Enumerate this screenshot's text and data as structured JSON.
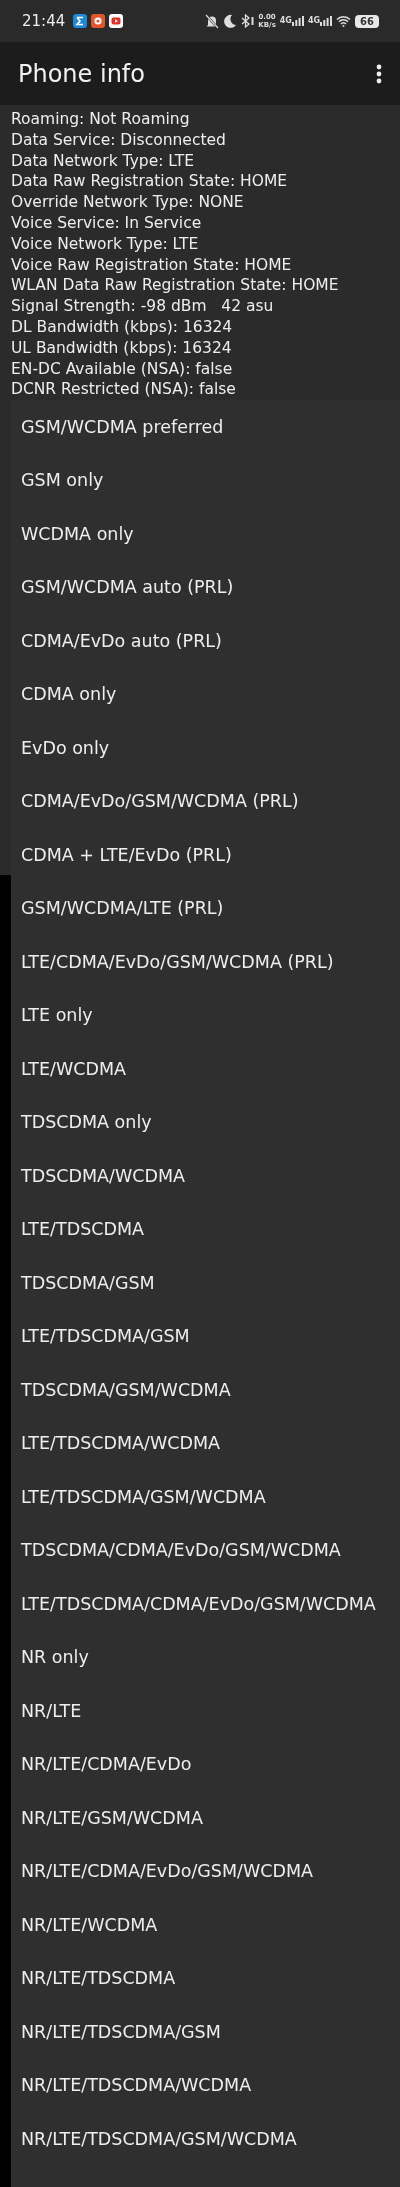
{
  "status_bar": {
    "time": "21:44",
    "net_speed": "0.00",
    "net_speed_unit": "KB/s",
    "network_1": "4G",
    "network_2": "4G",
    "battery": "66"
  },
  "app_bar": {
    "title": "Phone info"
  },
  "info_lines": [
    "Roaming: Not Roaming",
    "Data Service: Disconnected",
    "Data Network Type: LTE",
    "Data Raw Registration State: HOME",
    "Override Network Type: NONE",
    "Voice Service: In Service",
    "Voice Network Type: LTE",
    "Voice Raw Registration State: HOME",
    "WLAN Data Raw Registration State: HOME",
    "Signal Strength: -98 dBm   42 asu",
    "DL Bandwidth (kbps): 16324",
    "UL Bandwidth (kbps): 16324",
    "EN-DC Available (NSA): false",
    "DCNR Restricted (NSA): false"
  ],
  "network_type_menu": [
    "GSM/WCDMA preferred",
    "GSM only",
    "WCDMA only",
    "GSM/WCDMA auto (PRL)",
    "CDMA/EvDo auto (PRL)",
    "CDMA only",
    "EvDo only",
    "CDMA/EvDo/GSM/WCDMA (PRL)",
    "CDMA + LTE/EvDo (PRL)",
    "GSM/WCDMA/LTE (PRL)",
    "LTE/CDMA/EvDo/GSM/WCDMA (PRL)",
    "LTE only",
    "LTE/WCDMA",
    "TDSCDMA only",
    "TDSCDMA/WCDMA",
    "LTE/TDSCDMA",
    "TDSCDMA/GSM",
    "LTE/TDSCDMA/GSM",
    "TDSCDMA/GSM/WCDMA",
    "LTE/TDSCDMA/WCDMA",
    "LTE/TDSCDMA/GSM/WCDMA",
    "TDSCDMA/CDMA/EvDo/GSM/WCDMA",
    "LTE/TDSCDMA/CDMA/EvDo/GSM/WCDMA",
    "NR only",
    "NR/LTE",
    "NR/LTE/CDMA/EvDo",
    "NR/LTE/GSM/WCDMA",
    "NR/LTE/CDMA/EvDo/GSM/WCDMA",
    "NR/LTE/WCDMA",
    "NR/LTE/TDSCDMA",
    "NR/LTE/TDSCDMA/GSM",
    "NR/LTE/TDSCDMA/WCDMA",
    "NR/LTE/TDSCDMA/GSM/WCDMA"
  ]
}
